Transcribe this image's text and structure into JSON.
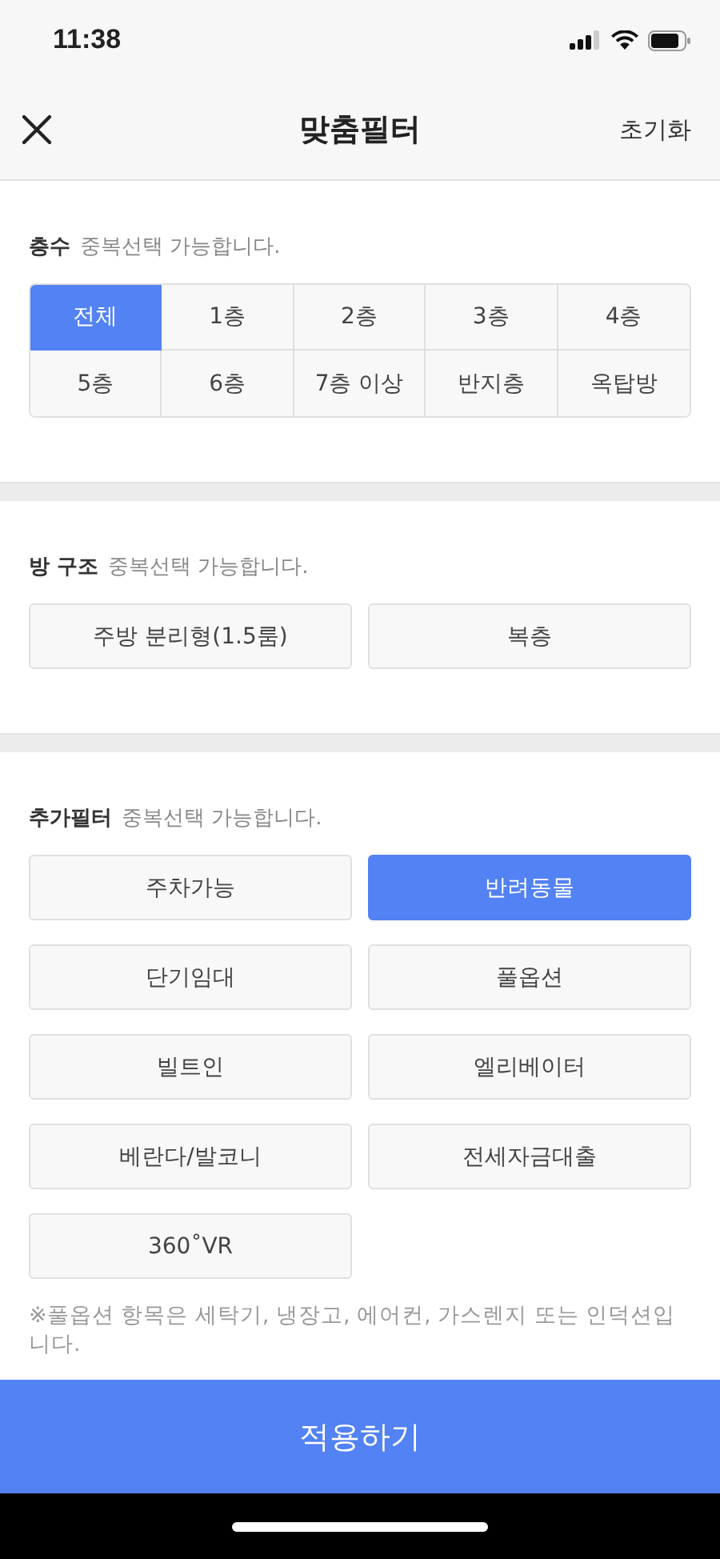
{
  "status_bar": {
    "time": "11:38"
  },
  "header": {
    "title": "맞춤필터",
    "reset": "초기화"
  },
  "sections": [
    {
      "kind": "segmented",
      "title": "층수",
      "hint": "중복선택 가능합니다.",
      "options": [
        {
          "label": "전체",
          "selected": true
        },
        {
          "label": "1층",
          "selected": false
        },
        {
          "label": "2층",
          "selected": false
        },
        {
          "label": "3층",
          "selected": false
        },
        {
          "label": "4층",
          "selected": false
        },
        {
          "label": "5층",
          "selected": false
        },
        {
          "label": "6층",
          "selected": false
        },
        {
          "label": "7층 이상",
          "selected": false
        },
        {
          "label": "반지층",
          "selected": false
        },
        {
          "label": "옥탑방",
          "selected": false
        }
      ]
    },
    {
      "kind": "chips",
      "title": "방 구조",
      "hint": "중복선택 가능합니다.",
      "options": [
        {
          "label": "주방 분리형(1.5룸)",
          "selected": false
        },
        {
          "label": "복층",
          "selected": false
        }
      ]
    },
    {
      "kind": "chips",
      "title": "추가필터",
      "hint": "중복선택 가능합니다.",
      "options": [
        {
          "label": "주차가능",
          "selected": false
        },
        {
          "label": "반려동물",
          "selected": true
        },
        {
          "label": "단기임대",
          "selected": false
        },
        {
          "label": "풀옵션",
          "selected": false
        },
        {
          "label": "빌트인",
          "selected": false
        },
        {
          "label": "엘리베이터",
          "selected": false
        },
        {
          "label": "베란다/발코니",
          "selected": false
        },
        {
          "label": "전세자금대출",
          "selected": false
        },
        {
          "label": "360˚VR",
          "selected": false
        }
      ],
      "note": "※풀옵션 항목은 세탁기, 냉장고, 에어컨, 가스렌지 또는 인덕션입니다."
    }
  ],
  "apply_button": "적용하기"
}
